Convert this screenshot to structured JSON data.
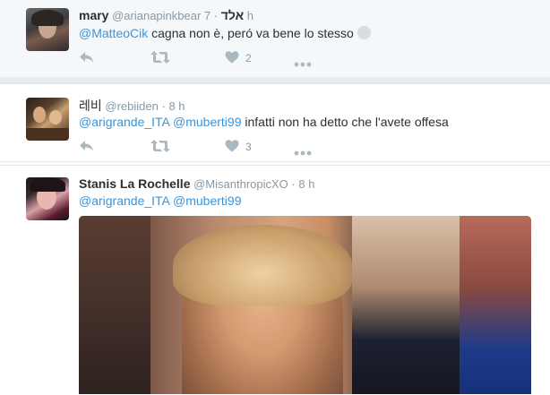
{
  "tweets": [
    {
      "name": "mary",
      "handle": "@arianapinkbear",
      "handle_extra": "אלד",
      "dot": "·",
      "time": "7 h",
      "mention": "@MatteoCik",
      "text": " cagna non è, peró va bene lo stesso",
      "likes": "2"
    },
    {
      "name": "레비",
      "handle": "@rebiiden",
      "dot": "·",
      "time": "8 h",
      "mention1": "@arigrande_ITA",
      "mention2": "@muberti99",
      "text": " infatti non ha detto che l'avete offesa",
      "likes": "3"
    },
    {
      "name": "Stanis La Rochelle",
      "handle": "@MisanthropicXO",
      "dot": "·",
      "time": "8 h",
      "mention1": "@arigrande_ITA",
      "mention2": "@muberti99"
    }
  ],
  "icons": {
    "reply": "reply-icon",
    "retweet": "retweet-icon",
    "like": "heart-icon",
    "more": "more-icon"
  },
  "colors": {
    "link": "#3b94d9",
    "muted": "#8899a6",
    "icon": "#aab8c2",
    "text": "#292f33"
  }
}
